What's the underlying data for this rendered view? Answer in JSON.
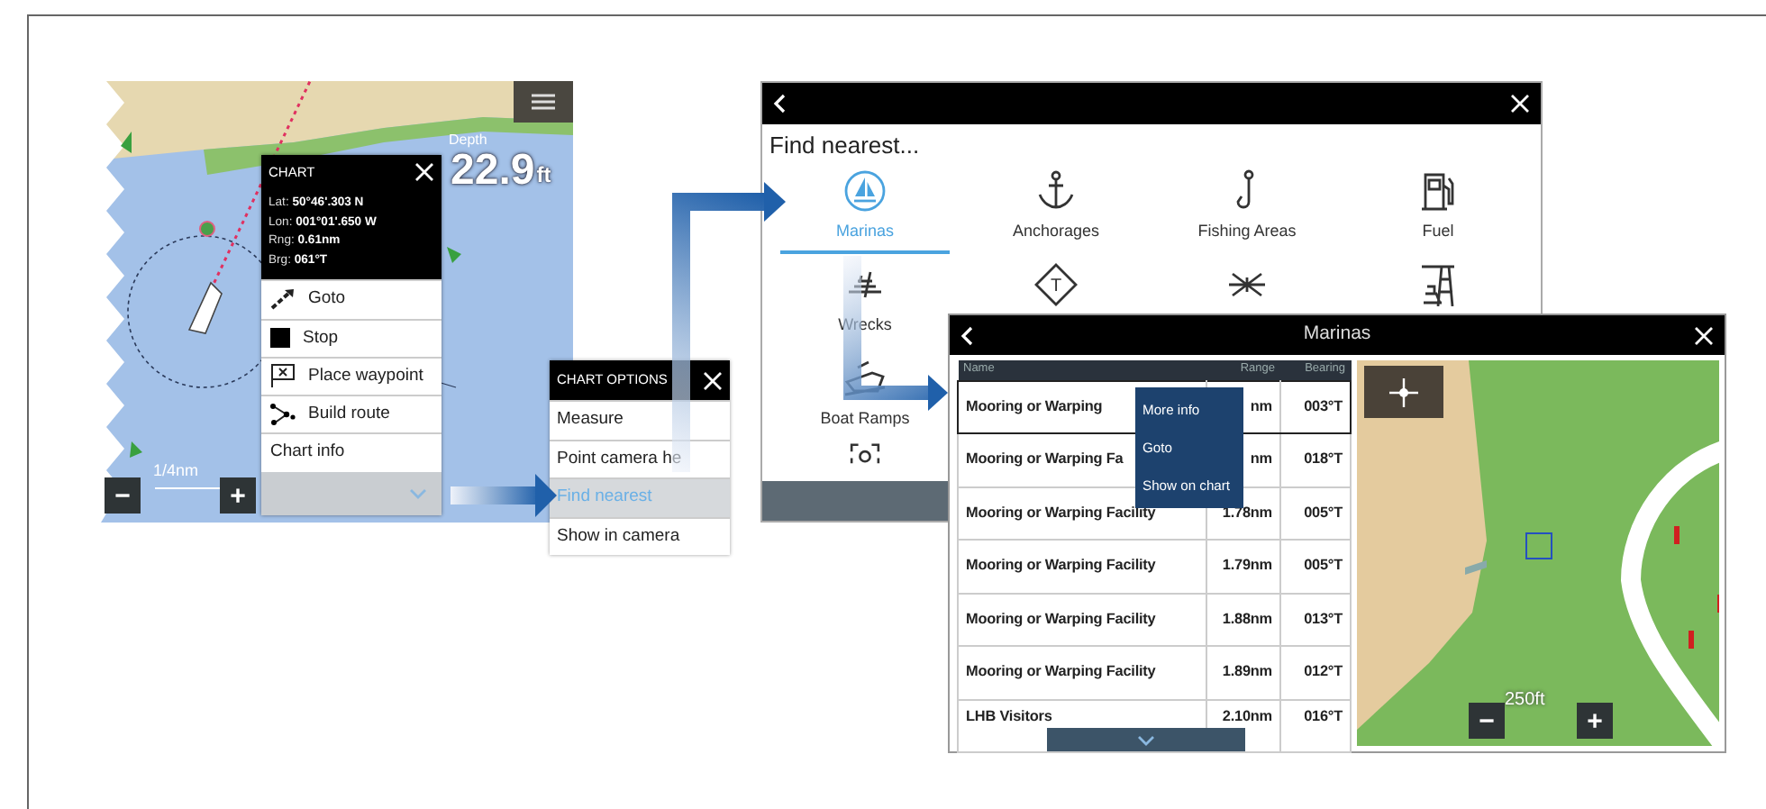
{
  "chart_screen": {
    "depth_label": "Depth",
    "depth_value": "22.9",
    "depth_unit": "ft",
    "scale": "1/4nm",
    "zoom_out": "−",
    "zoom_in": "+",
    "chart_menu": {
      "title": "CHART",
      "details": [
        "Lat: **50°46'.303 N**",
        "Lon: **001°01'.650 W**",
        "Rng: **0.61nm**",
        "Brg: **061°T**"
      ],
      "items": [
        {
          "kind": "goto",
          "label": "Goto"
        },
        {
          "kind": "stop",
          "label": "Stop"
        },
        {
          "kind": "waypoint",
          "label": "Place waypoint"
        },
        {
          "kind": "route",
          "label": "Build route"
        },
        {
          "kind": "plain",
          "label": "Chart info"
        }
      ]
    }
  },
  "chart_options": {
    "title": "CHART OPTIONS",
    "items": [
      {
        "label": "Measure",
        "selected": false
      },
      {
        "label": "Point camera he",
        "selected": false
      },
      {
        "label": "Find nearest",
        "selected": true
      },
      {
        "label": "Show in camera",
        "selected": false
      }
    ]
  },
  "find_nearest": {
    "title": "Find nearest...",
    "categories": [
      {
        "kind": "marina",
        "label": "Marinas",
        "selected": true
      },
      {
        "kind": "anchor",
        "label": "Anchorages",
        "selected": false
      },
      {
        "kind": "hook",
        "label": "Fishing Areas",
        "selected": false
      },
      {
        "kind": "fuel",
        "label": "Fuel",
        "selected": false
      },
      {
        "kind": "wreck",
        "label": "Wrecks",
        "selected": false
      },
      {
        "kind": "tide",
        "symbol": "T",
        "selected": false
      },
      {
        "kind": "cross",
        "selected": false
      },
      {
        "kind": "rig",
        "selected": false
      },
      {
        "kind": "ramp",
        "label": "Boat Ramps",
        "selected": false
      },
      {
        "kind": "scan",
        "selected": false
      }
    ]
  },
  "marinas": {
    "title": "Marinas",
    "columns": [
      "Name",
      "Range",
      "Bearing"
    ],
    "rows": [
      {
        "name": "Mooring or Warping",
        "range": "nm",
        "bearing": "003°T",
        "selected": true
      },
      {
        "name": "Mooring or Warping Fa",
        "range": "nm",
        "bearing": "018°T",
        "selected": false
      },
      {
        "name": "Mooring or Warping Facility",
        "range": "1.78nm",
        "bearing": "005°T",
        "selected": false
      },
      {
        "name": "Mooring or Warping Facility",
        "range": "1.79nm",
        "bearing": "005°T",
        "selected": false
      },
      {
        "name": "Mooring or Warping Facility",
        "range": "1.88nm",
        "bearing": "013°T",
        "selected": false
      },
      {
        "name": "Mooring or Warping Facility",
        "range": "1.89nm",
        "bearing": "012°T",
        "selected": false
      },
      {
        "name": "LHB Visitors",
        "range": "2.10nm",
        "bearing": "016°T",
        "selected": false
      }
    ],
    "popup": [
      "More info",
      "Goto",
      "Show on chart"
    ],
    "map_scale": "250ft",
    "zoom_out": "−",
    "zoom_in": "+"
  }
}
